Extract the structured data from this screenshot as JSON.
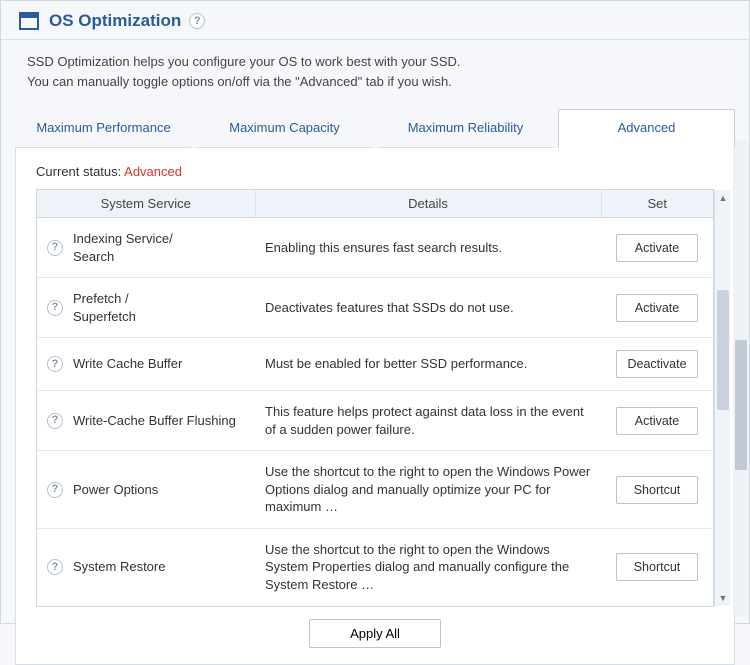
{
  "header": {
    "title": "OS Optimization"
  },
  "intro": {
    "line1": "SSD Optimization helps you configure your OS to work best with your SSD.",
    "line2": "You can manually toggle options on/off via the \"Advanced\" tab if you wish."
  },
  "tabs": {
    "t0": "Maximum Performance",
    "t1": "Maximum Capacity",
    "t2": "Maximum Reliability",
    "t3": "Advanced"
  },
  "status": {
    "label": "Current status: ",
    "value": "Advanced"
  },
  "columns": {
    "svc": "System Service",
    "det": "Details",
    "set": "Set"
  },
  "rows": [
    {
      "name": "Indexing Service/\nSearch",
      "details": "Enabling this ensures fast search results.",
      "action": "Activate"
    },
    {
      "name": "Prefetch /\nSuperfetch",
      "details": "Deactivates features that SSDs do not use.",
      "action": "Activate"
    },
    {
      "name": "Write Cache Buffer",
      "details": "Must be enabled for better SSD performance.",
      "action": "Deactivate"
    },
    {
      "name": "Write-Cache Buffer Flushing",
      "details": "This feature helps protect against data loss in the event of a sudden power failure.",
      "action": "Activate"
    },
    {
      "name": "Power Options",
      "details": "Use the shortcut to the right to open the Windows Power Options dialog and manually optimize your PC for maximum …",
      "action": "Shortcut"
    },
    {
      "name": "System Restore",
      "details": "Use the shortcut to the right to open the Windows System Properties dialog and manually configure the System Restore …",
      "action": "Shortcut"
    }
  ],
  "apply": {
    "label": "Apply All"
  }
}
